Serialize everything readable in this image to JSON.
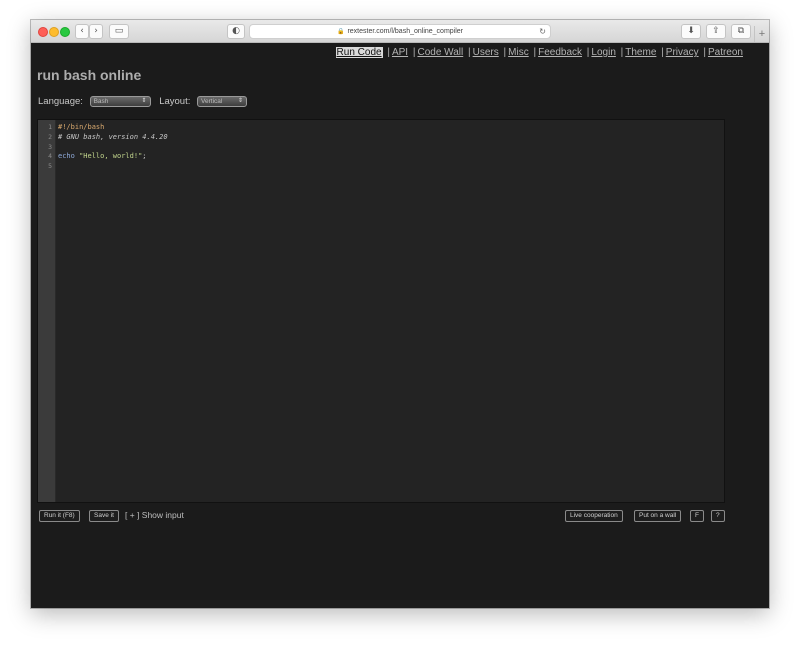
{
  "browser": {
    "url": "rextester.com/l/bash_online_compiler",
    "lock_glyph": "🔒",
    "reload_glyph": "↻",
    "back_glyph": "‹",
    "forward_glyph": "›",
    "sidebar_glyph": "▭",
    "shield_glyph": "◐",
    "download_glyph": "⬇",
    "share_glyph": "⇪",
    "tabs_glyph": "⧉",
    "newtab_glyph": "+"
  },
  "nav": {
    "items": [
      "Run Code",
      "API",
      "Code Wall",
      "Users",
      "Misc",
      "Feedback",
      "Login",
      "Theme",
      "Privacy",
      "Patreon"
    ],
    "separator": "|"
  },
  "page": {
    "title": "run bash online"
  },
  "controls": {
    "language_label": "Language:",
    "language_value": "Bash",
    "layout_label": "Layout:",
    "layout_value": "Vertical",
    "select_arrow": "⇕"
  },
  "editor": {
    "line_numbers": [
      "1",
      "2",
      "3",
      "4",
      "5"
    ],
    "lines": {
      "shebang": "#!/bin/bash",
      "comment": "# GNU bash, version 4.4.20",
      "echo_kw": "echo",
      "echo_str": "\"Hello, world!\"",
      "echo_end": ";"
    }
  },
  "actions": {
    "run": "Run it (F8)",
    "save": "Save it",
    "show_input": "[ + ] Show input",
    "live": "Live cooperation",
    "wall": "Put on a wall",
    "fullscreen": "F",
    "help": "?"
  },
  "colors": {
    "page_bg": "#1b1b1b",
    "editor_bg": "#232323",
    "gutter_bg": "#3b3b3b",
    "string": "#c3d68d",
    "keyword": "#8ea9d8",
    "shebang": "#d7a86e"
  }
}
